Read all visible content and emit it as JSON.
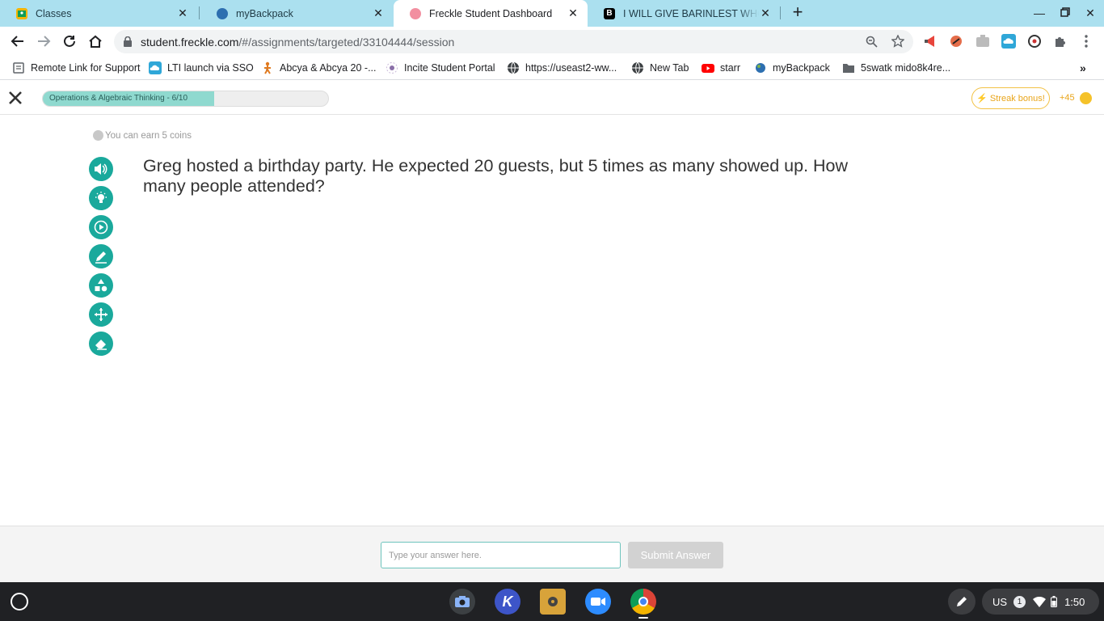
{
  "browser": {
    "tabs": [
      {
        "title": "Classes",
        "favicon": "classroom-icon",
        "color": "#f4b400"
      },
      {
        "title": "myBackpack",
        "favicon": "globe-icon",
        "color": "#2d6fb0"
      },
      {
        "title": "Freckle Student Dashboard",
        "favicon": "freckle-pig-icon",
        "color": "#f28fa0"
      },
      {
        "title": "I WILL GIVE BARINLEST WHO HE",
        "favicon": "brainly-icon",
        "color": "#000000"
      }
    ],
    "url_host": "student.freckle.com",
    "url_path": "/#/assignments/targeted/33104444/session"
  },
  "bookmarks": [
    {
      "label": "Remote Link for Support",
      "icon": "document-icon"
    },
    {
      "label": "LTI launch via SSO",
      "icon": "cloud-icon"
    },
    {
      "label": "Abcya & Abcya 20 -...",
      "icon": "runner-icon"
    },
    {
      "label": "Incite Student Portal",
      "icon": "sparkle-icon"
    },
    {
      "label": "https://useast2-ww...",
      "icon": "globe-icon"
    },
    {
      "label": "New Tab",
      "icon": "globe-icon"
    },
    {
      "label": "starr",
      "icon": "youtube-icon"
    },
    {
      "label": "myBackpack",
      "icon": "globe-icon"
    },
    {
      "label": "5swatk mido8k4re...",
      "icon": "folder-icon"
    }
  ],
  "freckle": {
    "progress_label": "Operations & Algebraic Thinking - 6/10",
    "progress_fraction": 0.6,
    "streak_label": "⚡ Streak bonus!",
    "coins_label": "+45",
    "earn_text": "You can earn 5 coins",
    "question": "Greg hosted a birthday party. He expected 20 guests, but 5 times as many showed up. How many people attended?",
    "answer_placeholder": "Type your answer here.",
    "submit_label": "Submit Answer",
    "accent": "#1aa99c",
    "tools": [
      "speaker-icon",
      "lightbulb-icon",
      "video-icon",
      "pencil-icon",
      "shapes-icon",
      "move-icon",
      "eraser-icon"
    ]
  },
  "shelf": {
    "input_method": "US",
    "notification_count": "1",
    "time": "1:50"
  }
}
